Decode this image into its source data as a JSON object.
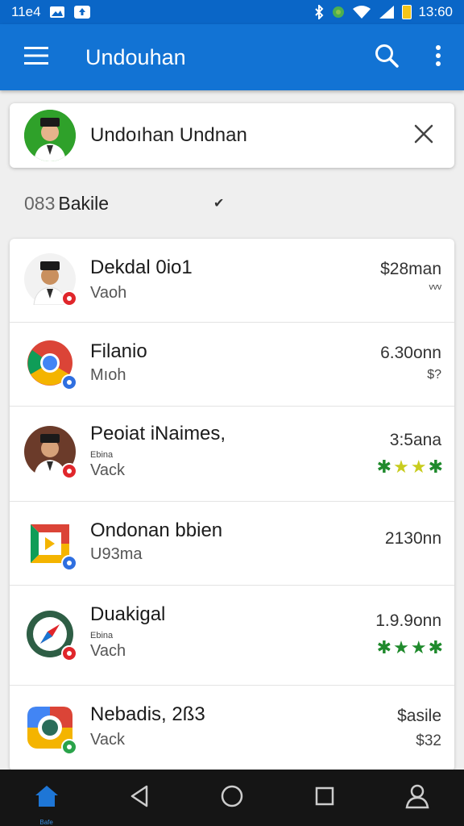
{
  "status": {
    "time_left": "11e4",
    "time_right": "13:60",
    "icons_left": [
      "image-icon",
      "cloud-upload-icon"
    ],
    "icons_right": [
      "bluetooth-icon",
      "vpn-icon",
      "wifi-icon",
      "signal-icon",
      "battery-icon"
    ]
  },
  "appbar": {
    "title": "Undouhan",
    "menu_icon": "hamburger-menu-icon",
    "search_icon": "search-icon",
    "more_icon": "more-vertical-icon"
  },
  "search": {
    "value": "Undoıhan Undnan",
    "clear_icon": "close-icon"
  },
  "section": {
    "number": "083",
    "label": "Bakile",
    "check": "✔"
  },
  "list": [
    {
      "title": "Dekdal 0io1",
      "subtitle": "Vaoh",
      "value": "$28man",
      "meta": "ᵛᵛᵛ",
      "badge_color": "#e0262b"
    },
    {
      "title": "Filanio",
      "subtitle": "Mıoh",
      "value": "6.30onn",
      "meta": "$?",
      "badge_color": "#2f6fe0"
    },
    {
      "title": "Peoiat iNaimes,",
      "small": "Ebina",
      "subtitle": "Vack",
      "value": "3:5ana",
      "rating": 4,
      "badge_color": "#e0262b"
    },
    {
      "title": "Ondonan bbien",
      "subtitle": "U93ma",
      "value": "2130nn",
      "badge_color": "#2f6fe0"
    },
    {
      "title": "Duakigal",
      "small": "Ebina",
      "subtitle": "Vach",
      "value": "1.9.9onn",
      "rating": 4,
      "badge_color": "#e0262b"
    },
    {
      "title": "Nebadis, 2ß3",
      "subtitle": "Vack",
      "value": "$asile",
      "meta": "$32",
      "badge_color": "#2aa34a"
    }
  ],
  "navbar": {
    "home_label": "Bafe",
    "items": [
      "home-icon",
      "back-icon",
      "home-circle-icon",
      "recents-icon",
      "profile-icon"
    ]
  },
  "colors": {
    "statusbar": "#0a66c7",
    "appbar": "#1273d4",
    "star_yellow": "#c8cc1e",
    "star_green": "#1f8a2c",
    "nav_active": "#1e76d6"
  }
}
